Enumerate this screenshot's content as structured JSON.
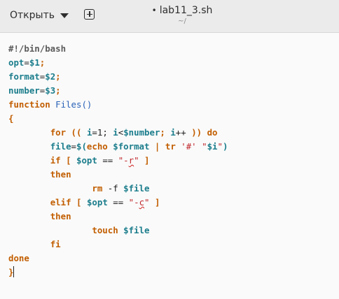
{
  "header": {
    "open_label": "Открыть",
    "title_dot": "•",
    "title": "lab11_3.sh",
    "subtitle": "~/"
  },
  "code": {
    "shebang": "#!/bin/bash",
    "l2_var": "opt",
    "l2_eq": "=",
    "l2_val": "$1",
    "l2_semi": ";",
    "l3_var": "format",
    "l3_eq": "=",
    "l3_val": "$2",
    "l3_semi": ";",
    "l4_var": "number",
    "l4_eq": "=",
    "l4_val": "$3",
    "l4_semi": ";",
    "l5_kw": "function",
    "l5_fn": "Files()",
    "l6_brace": "{",
    "l7_for": "for",
    "l7_open": "((",
    "l7_i": "i",
    "l7_eq": "=1; ",
    "l7_i2": "i",
    "l7_lt": "<",
    "l7_num": "$number",
    "l7_semi": "; ",
    "l7_i3": "i",
    "l7_pp": "++ ",
    "l7_close": "))",
    "l7_do": "do",
    "l8_file": "file",
    "l8_eq": "=",
    "l8_sub": "$(",
    "l8_echo": "echo",
    "l8_fmt": "$format",
    "l8_pipe": "|",
    "l8_tr": "tr",
    "l8_s1": "'#'",
    "l8_s2a": "\"",
    "l8_s2v": "$i",
    "l8_s2b": "\"",
    "l8_close": ")",
    "l9_if": "if",
    "l9_br": "[",
    "l9_var": "$opt",
    "l9_op": "==",
    "l9_str_a": "\"-",
    "l9_str_r": "r",
    "l9_str_b": "\"",
    "l9_br2": "]",
    "l10_then": "then",
    "l11_rm": "rm",
    "l11_flag": "-f",
    "l11_var": "$file",
    "l12_elif": "elif",
    "l12_br": "[",
    "l12_var": "$opt",
    "l12_op": "==",
    "l12_str_a": "\"-",
    "l12_str_c": "c",
    "l12_str_b": "\"",
    "l12_br2": "]",
    "l13_then": "then",
    "l14_touch": "touch",
    "l14_var": "$file",
    "l15_fi": "fi",
    "l16_done": "done",
    "l17_brace": "}"
  },
  "colors": {
    "keyword": "#c25e00",
    "variable": "#1b7d8c",
    "function": "#2a62b8",
    "string": "#c0282d"
  },
  "icons": {
    "dropdown": "chevron-down-icon",
    "new_tab": "new-tab-icon"
  }
}
